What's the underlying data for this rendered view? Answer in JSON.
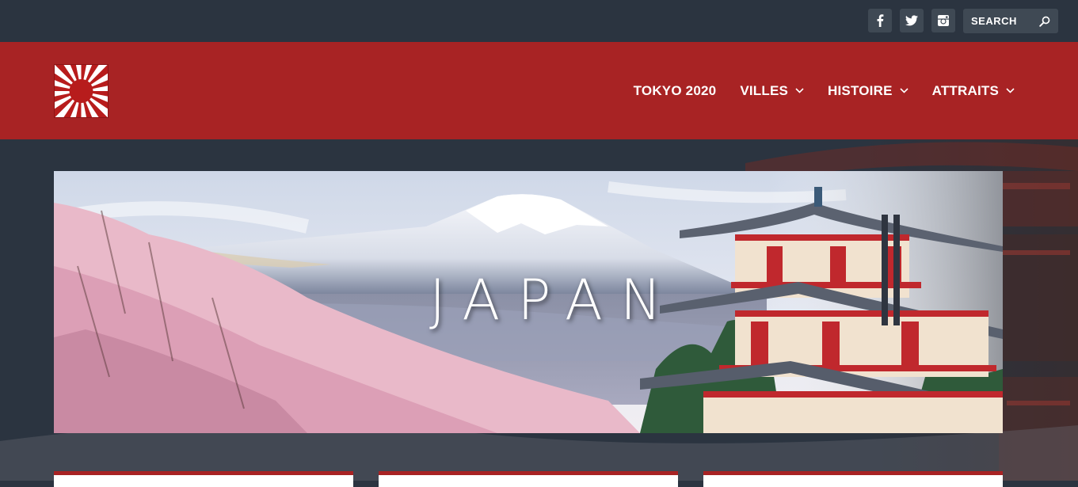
{
  "colors": {
    "topbar_bg": "#2b3440",
    "header_bg": "#a82324",
    "accent": "#a82324",
    "social_bg": "#3f4954",
    "text_light": "#ffffff"
  },
  "topbar": {
    "social": [
      {
        "name": "facebook",
        "icon": "facebook-icon"
      },
      {
        "name": "twitter",
        "icon": "twitter-icon"
      },
      {
        "name": "instagram",
        "icon": "instagram-icon"
      }
    ],
    "search": {
      "placeholder": "SEARCH",
      "value": "",
      "icon": "search-icon"
    }
  },
  "header": {
    "logo_icon": "rising-sun-flag-icon",
    "nav": [
      {
        "label": "TOKYO 2020",
        "has_dropdown": false
      },
      {
        "label": "VILLES",
        "has_dropdown": true
      },
      {
        "label": "HISTOIRE",
        "has_dropdown": true
      },
      {
        "label": "ATTRAITS",
        "has_dropdown": true
      }
    ]
  },
  "banner": {
    "title": "JAPAN",
    "image": "mount-fuji-pagoda-cherry-blossoms"
  },
  "cards": [
    {
      "name": "card-1"
    },
    {
      "name": "card-2"
    },
    {
      "name": "card-3"
    }
  ]
}
